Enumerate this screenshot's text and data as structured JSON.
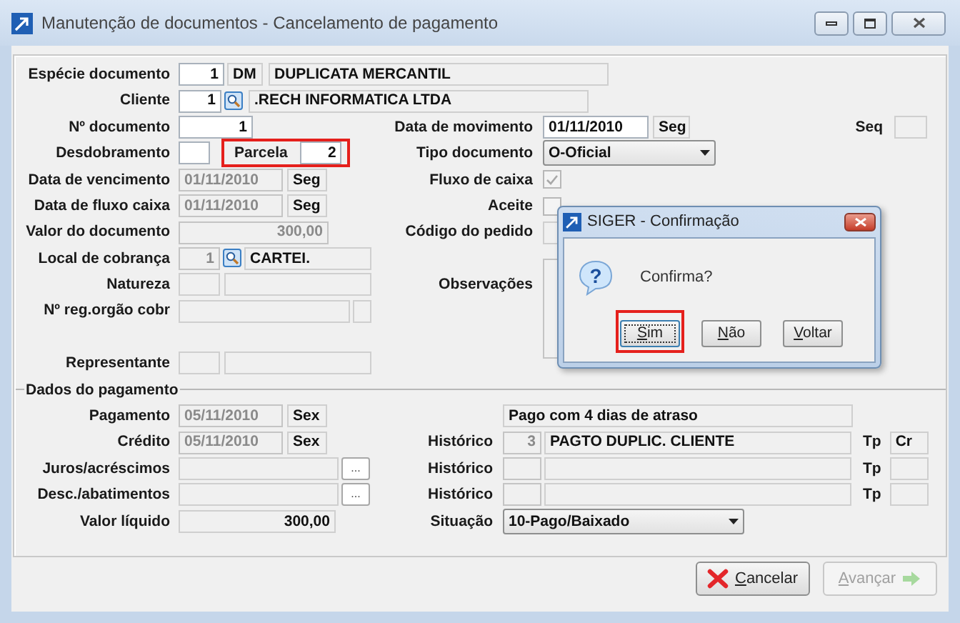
{
  "window": {
    "title": "Manutenção de documentos - Cancelamento de pagamento"
  },
  "especie": {
    "label": "Espécie documento",
    "code": "1",
    "abbr": "DM",
    "name": "DUPLICATA MERCANTIL"
  },
  "cliente": {
    "label": "Cliente",
    "code": "1",
    "name": ".RECH INFORMATICA LTDA"
  },
  "numero": {
    "label": "Nº documento",
    "value": "1"
  },
  "data_movimento": {
    "label": "Data de movimento",
    "value": "01/11/2010",
    "weekday": "Seg"
  },
  "seq": {
    "label": "Seq"
  },
  "desdobramento": {
    "label": "Desdobramento"
  },
  "parcela": {
    "label": "Parcela",
    "value": "2",
    "highlighted": true
  },
  "tipo_documento": {
    "label": "Tipo documento",
    "value": "O-Oficial"
  },
  "vencimento": {
    "label": "Data de vencimento",
    "value": "01/11/2010",
    "weekday": "Seg",
    "disabled": true
  },
  "fluxo_caixa": {
    "label": "Fluxo de caixa",
    "checked": true
  },
  "data_fluxo": {
    "label": "Data de fluxo caixa",
    "value": "01/11/2010",
    "weekday": "Seg",
    "disabled": true
  },
  "aceite": {
    "label": "Aceite",
    "checked": false
  },
  "valor_documento": {
    "label": "Valor do documento",
    "value": "300,00",
    "disabled": true
  },
  "codigo_pedido": {
    "label": "Código do pedido"
  },
  "local_cobranca": {
    "label": "Local de cobrança",
    "code": "1",
    "name": "CARTEI."
  },
  "natureza": {
    "label": "Natureza"
  },
  "observacoes": {
    "label": "Observações"
  },
  "registro": {
    "label": "Nº reg.orgão cobr"
  },
  "representante": {
    "label": "Representante"
  },
  "pagamento_section": {
    "title": "Dados do pagamento"
  },
  "pagamento": {
    "label": "Pagamento",
    "value": "05/11/2010",
    "weekday": "Sex",
    "disabled": true
  },
  "nota": {
    "value": "Pago com 4 dias de atraso"
  },
  "credito": {
    "label": "Crédito",
    "value": "05/11/2010",
    "weekday": "Sex",
    "disabled": true
  },
  "juros": {
    "label": "Juros/acréscimos",
    "button": "..."
  },
  "descontos": {
    "label": "Desc./abatimentos",
    "button": "..."
  },
  "valor_liquido": {
    "label": "Valor líquido",
    "value": "300,00"
  },
  "historicos": [
    {
      "label": "Histórico",
      "code": "3",
      "text": "PAGTO DUPLIC. CLIENTE",
      "tp_label": "Tp",
      "tp": "Cr"
    },
    {
      "label": "Histórico",
      "tp_label": "Tp"
    },
    {
      "label": "Histórico",
      "tp_label": "Tp"
    }
  ],
  "situacao": {
    "label": "Situação",
    "value": "10-Pago/Baixado"
  },
  "buttons": [
    {
      "label": "Cancelar",
      "kind": "cancel",
      "disabled": false
    },
    {
      "label": "Avançar",
      "kind": "next",
      "disabled": true
    }
  ],
  "dialog": {
    "title": "SIGER - Confirmação",
    "icon": "?",
    "message": "Confirma?",
    "buttons": [
      {
        "label": "Sim",
        "selected": true,
        "highlighted": true
      },
      {
        "label": "Não",
        "selected": false,
        "highlighted": false
      },
      {
        "label": "Voltar",
        "selected": false,
        "highlighted": false
      }
    ]
  }
}
